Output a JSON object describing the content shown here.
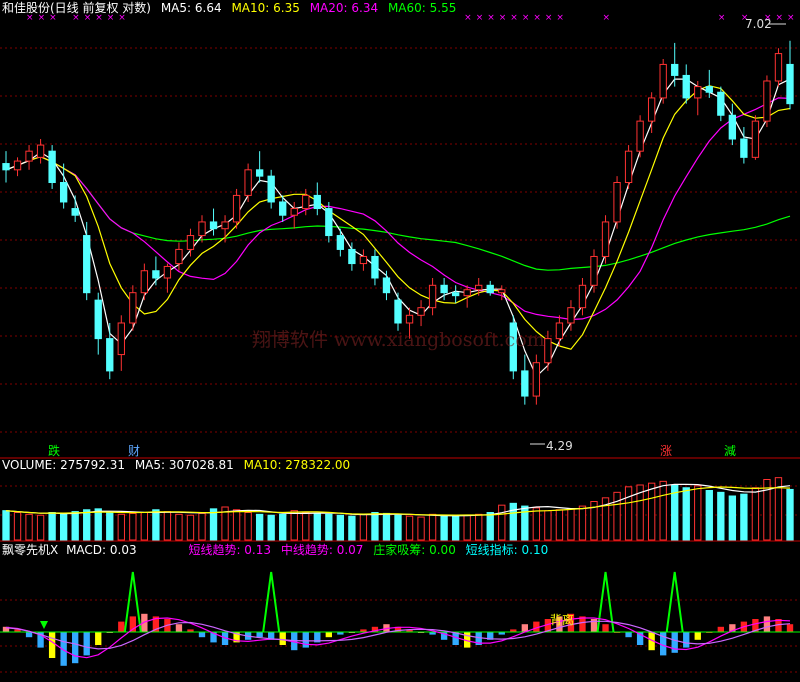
{
  "colors": {
    "bg": "#000000",
    "up": "#ff3232",
    "down": "#54ffff",
    "ma5": "#ffffff",
    "ma10": "#ffff00",
    "ma20": "#ff00ff",
    "ma60": "#00ff00",
    "grid": "#800000",
    "white": "#ffffff",
    "purple": "#ff00ff",
    "green": "#00ff00"
  },
  "price_header": {
    "name": "和佳股份(日线 前复权 对数)",
    "ma5": "MA5: 6.64",
    "ma10": "MA10: 6.35",
    "ma20": "MA20: 6.34",
    "ma60": "MA60: 5.55"
  },
  "annotations": {
    "high": "7.02",
    "low": "4.29",
    "watermark": "翔博软件 www.xiangbosoft.com"
  },
  "event_markers": [
    {
      "label": "跌",
      "color": "#00ff00"
    },
    {
      "label": "财",
      "color": "#5fa8ff"
    },
    {
      "label": "涨",
      "color": "#ff3232"
    },
    {
      "label": "減",
      "color": "#00ff00"
    }
  ],
  "volume_header": {
    "vol": "VOLUME: 275792.31",
    "ma5": "MA5: 307028.81",
    "ma10": "MA10: 278322.00"
  },
  "indicator_header": {
    "name": "飘零先机X",
    "macd": "MACD: 0.03",
    "short": "短线趋势: 0.13",
    "mid": "中线趋势: 0.07",
    "zhuang": "庄家吸筹: 0.00",
    "index": "短线指标: 0.10",
    "divergence": "背离"
  },
  "chart_data": {
    "type": "candlestick",
    "title": "和佳股份(日线 前复权 对数)",
    "y_scale": "log",
    "ylim": [
      4.1,
      7.2
    ],
    "ohlc": [
      [
        5.95,
        6.05,
        5.8,
        5.9
      ],
      [
        5.9,
        6.0,
        5.85,
        5.97
      ],
      [
        5.97,
        6.1,
        5.9,
        6.05
      ],
      [
        6.0,
        6.15,
        5.95,
        6.1
      ],
      [
        6.05,
        6.1,
        5.75,
        5.8
      ],
      [
        5.8,
        5.95,
        5.6,
        5.65
      ],
      [
        5.6,
        5.7,
        5.5,
        5.55
      ],
      [
        5.4,
        5.5,
        4.95,
        5.0
      ],
      [
        4.95,
        5.0,
        4.6,
        4.7
      ],
      [
        4.7,
        4.8,
        4.45,
        4.5
      ],
      [
        4.6,
        4.85,
        4.5,
        4.8
      ],
      [
        4.8,
        5.05,
        4.75,
        5.0
      ],
      [
        5.0,
        5.2,
        4.95,
        5.15
      ],
      [
        5.15,
        5.25,
        5.05,
        5.1
      ],
      [
        5.1,
        5.2,
        5.0,
        5.18
      ],
      [
        5.2,
        5.35,
        5.15,
        5.3
      ],
      [
        5.3,
        5.45,
        5.25,
        5.4
      ],
      [
        5.4,
        5.55,
        5.35,
        5.5
      ],
      [
        5.5,
        5.6,
        5.4,
        5.45
      ],
      [
        5.45,
        5.55,
        5.35,
        5.5
      ],
      [
        5.5,
        5.75,
        5.45,
        5.7
      ],
      [
        5.7,
        5.95,
        5.65,
        5.9
      ],
      [
        5.9,
        6.05,
        5.8,
        5.85
      ],
      [
        5.85,
        5.9,
        5.6,
        5.65
      ],
      [
        5.65,
        5.7,
        5.5,
        5.55
      ],
      [
        5.55,
        5.65,
        5.45,
        5.6
      ],
      [
        5.6,
        5.75,
        5.55,
        5.7
      ],
      [
        5.7,
        5.8,
        5.55,
        5.6
      ],
      [
        5.6,
        5.65,
        5.35,
        5.4
      ],
      [
        5.4,
        5.45,
        5.25,
        5.3
      ],
      [
        5.3,
        5.35,
        5.15,
        5.2
      ],
      [
        5.2,
        5.3,
        5.15,
        5.25
      ],
      [
        5.25,
        5.3,
        5.05,
        5.1
      ],
      [
        5.1,
        5.15,
        4.95,
        5.0
      ],
      [
        4.95,
        5.0,
        4.75,
        4.8
      ],
      [
        4.8,
        4.9,
        4.7,
        4.85
      ],
      [
        4.85,
        4.95,
        4.78,
        4.9
      ],
      [
        4.9,
        5.1,
        4.85,
        5.05
      ],
      [
        5.05,
        5.1,
        4.95,
        5.0
      ],
      [
        5.0,
        5.05,
        4.93,
        4.98
      ],
      [
        4.98,
        5.05,
        4.9,
        5.02
      ],
      [
        5.02,
        5.1,
        4.98,
        5.05
      ],
      [
        5.05,
        5.08,
        4.98,
        5.0
      ],
      [
        5.0,
        5.05,
        4.95,
        5.02
      ],
      [
        4.8,
        4.85,
        4.45,
        4.5
      ],
      [
        4.5,
        4.6,
        4.3,
        4.35
      ],
      [
        4.35,
        4.6,
        4.3,
        4.55
      ],
      [
        4.55,
        4.75,
        4.5,
        4.7
      ],
      [
        4.7,
        4.85,
        4.65,
        4.8
      ],
      [
        4.8,
        4.95,
        4.75,
        4.9
      ],
      [
        4.9,
        5.1,
        4.85,
        5.05
      ],
      [
        5.05,
        5.3,
        5.0,
        5.25
      ],
      [
        5.25,
        5.55,
        5.2,
        5.5
      ],
      [
        5.5,
        5.85,
        5.45,
        5.8
      ],
      [
        5.8,
        6.1,
        5.75,
        6.05
      ],
      [
        6.05,
        6.35,
        6.0,
        6.3
      ],
      [
        6.3,
        6.55,
        6.2,
        6.5
      ],
      [
        6.5,
        6.85,
        6.45,
        6.8
      ],
      [
        6.8,
        7.0,
        6.6,
        6.7
      ],
      [
        6.7,
        6.8,
        6.45,
        6.5
      ],
      [
        6.5,
        6.65,
        6.35,
        6.6
      ],
      [
        6.6,
        6.75,
        6.5,
        6.55
      ],
      [
        6.55,
        6.6,
        6.3,
        6.35
      ],
      [
        6.35,
        6.45,
        6.1,
        6.15
      ],
      [
        6.15,
        6.25,
        5.95,
        6.0
      ],
      [
        6.0,
        6.35,
        5.98,
        6.3
      ],
      [
        6.3,
        6.7,
        6.25,
        6.65
      ],
      [
        6.65,
        6.95,
        6.6,
        6.9
      ],
      [
        6.8,
        7.02,
        6.4,
        6.45
      ]
    ],
    "volume": [
      160000,
      150000,
      140000,
      135000,
      150000,
      145000,
      155000,
      165000,
      170000,
      150000,
      140000,
      145000,
      150000,
      165000,
      155000,
      140000,
      135000,
      145000,
      170000,
      180000,
      165000,
      150000,
      140000,
      135000,
      140000,
      160000,
      150000,
      145000,
      140000,
      135000,
      130000,
      140000,
      150000,
      145000,
      135000,
      130000,
      125000,
      140000,
      135000,
      130000,
      135000,
      140000,
      150000,
      190000,
      200000,
      185000,
      175000,
      160000,
      165000,
      170000,
      185000,
      210000,
      230000,
      260000,
      290000,
      300000,
      310000,
      320000,
      300000,
      285000,
      295000,
      270000,
      260000,
      240000,
      250000,
      285000,
      330000,
      340000,
      275792
    ],
    "macd": [
      0.02,
      0.01,
      -0.02,
      -0.06,
      -0.1,
      -0.13,
      -0.12,
      -0.09,
      -0.05,
      0.0,
      0.04,
      0.06,
      0.07,
      0.06,
      0.05,
      0.03,
      0.01,
      -0.02,
      -0.04,
      -0.05,
      -0.04,
      -0.03,
      -0.02,
      -0.03,
      -0.05,
      -0.07,
      -0.06,
      -0.04,
      -0.02,
      -0.01,
      0.0,
      0.01,
      0.02,
      0.03,
      0.02,
      0.01,
      0.0,
      -0.01,
      -0.03,
      -0.05,
      -0.06,
      -0.05,
      -0.03,
      -0.01,
      0.01,
      0.03,
      0.04,
      0.05,
      0.06,
      0.07,
      0.06,
      0.05,
      0.03,
      0.0,
      -0.02,
      -0.05,
      -0.07,
      -0.09,
      -0.08,
      -0.06,
      -0.03,
      0.0,
      0.02,
      0.03,
      0.04,
      0.05,
      0.06,
      0.05,
      0.03
    ]
  }
}
